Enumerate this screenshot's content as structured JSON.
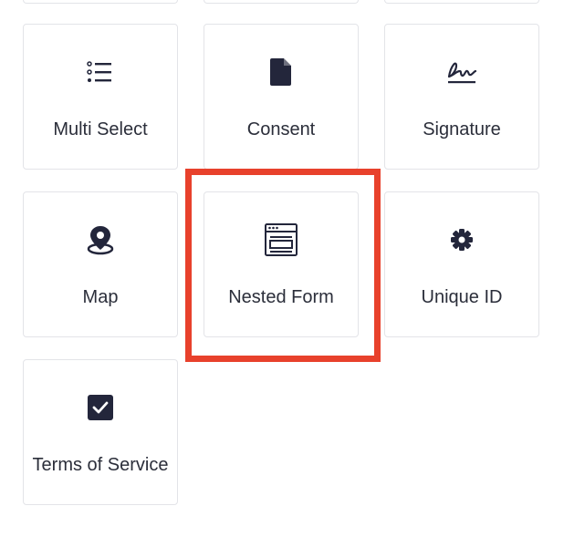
{
  "fields": [
    {
      "label": "Multi Select",
      "icon": "list-icon"
    },
    {
      "label": "Consent",
      "icon": "document-icon"
    },
    {
      "label": "Signature",
      "icon": "signature-icon"
    },
    {
      "label": "Map",
      "icon": "map-pin-icon"
    },
    {
      "label": "Nested Form",
      "icon": "form-window-icon"
    },
    {
      "label": "Unique ID",
      "icon": "gear-icon"
    },
    {
      "label": "Terms of Service",
      "icon": "checkbox-icon"
    }
  ],
  "colors": {
    "icon": "#23263b",
    "text": "#2b2e3a",
    "border": "#e3e4e8",
    "highlight": "#e8412c"
  }
}
